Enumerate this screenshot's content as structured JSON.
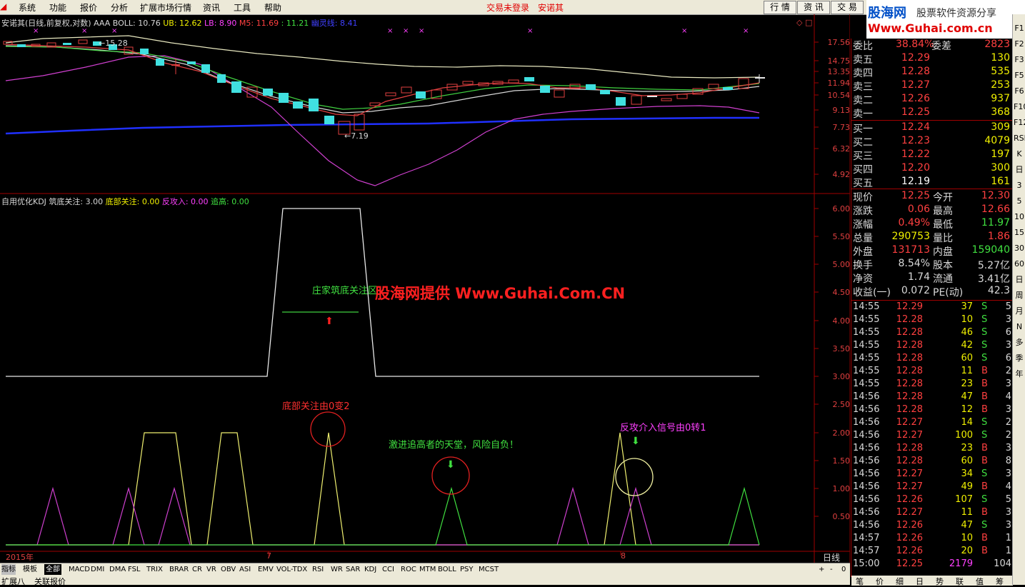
{
  "menu": [
    "系统",
    "功能",
    "报价",
    "分析",
    "扩展市场行情",
    "资讯",
    "工具",
    "帮助"
  ],
  "status": {
    "login": "交易未登录",
    "stock": "安诺其"
  },
  "toolbar_buttons": [
    "行 情",
    "资 讯",
    "交 易"
  ],
  "logo": {
    "line1": "股海网",
    "line1b": "股票软件资源分享",
    "line2": "Www.Guhai.com.cn"
  },
  "main_info": {
    "title": "安诺其(日线,前复权,对数)",
    "aaa": "AAA",
    "boll": "BOLL: 10.76",
    "ub": "UB: 12.62",
    "lb": "LB: 8.90",
    "m5": "M5: 11.69",
    "m10": ": 11.21",
    "ghost": "幽灵线: 8.41"
  },
  "price_axis": [
    "17.56",
    "14.75",
    "13.35",
    "11.94",
    "10.54",
    "9.13",
    "7.73",
    "6.32",
    "4.92"
  ],
  "price_annot": {
    "high": "15.28",
    "low": "7.19"
  },
  "kdj_info": {
    "title": "自用优化KDJ",
    "a": "筑底关注: 3.00",
    "b": "底部关注: 0.00",
    "c": "反攻入: 0.00",
    "d": "追高: 0.00"
  },
  "kdj_axis": [
    "6.00",
    "5.50",
    "5.00",
    "4.50",
    "4.00",
    "3.50",
    "3.00",
    "2.50",
    "2.00",
    "1.50",
    "1.00",
    "0.50"
  ],
  "annotations": {
    "a1": "庄家筑底关注区",
    "a2": "底部关注由0变2",
    "a3": "激进追高者的天堂，风险自负！",
    "a4": "反攻介入信号由0转1",
    "watermark": "股海网提供 Www.Guhai.Com.CN"
  },
  "date_axis": {
    "year": "2015年",
    "m7": "7",
    "m8": "8",
    "period": "日线"
  },
  "indicator_tabs": [
    "指标",
    "模板",
    "全部",
    "MACD",
    "DMI",
    "DMA",
    "FSL",
    "TRIX",
    "BRAR",
    "CR",
    "VR",
    "OBV",
    "ASI",
    "EMV",
    "VOL-TDX",
    "RSI",
    "WR",
    "SAR",
    "KDJ",
    "CCI",
    "ROC",
    "MTM",
    "BOLL",
    "PSY",
    "MCST"
  ],
  "bottom": [
    "扩展八",
    "关联报价"
  ],
  "quote": {
    "ratio": {
      "label": "委比",
      "value": "38.84%",
      "label2": "委差",
      "value2": "2823"
    },
    "sells": [
      {
        "label": "卖五",
        "price": "12.29",
        "vol": "130"
      },
      {
        "label": "卖四",
        "price": "12.28",
        "vol": "535"
      },
      {
        "label": "卖三",
        "price": "12.27",
        "vol": "253"
      },
      {
        "label": "卖二",
        "price": "12.26",
        "vol": "937"
      },
      {
        "label": "卖一",
        "price": "12.25",
        "vol": "368"
      }
    ],
    "buys": [
      {
        "label": "买一",
        "price": "12.24",
        "vol": "309"
      },
      {
        "label": "买二",
        "price": "12.23",
        "vol": "4079"
      },
      {
        "label": "买三",
        "price": "12.22",
        "vol": "197"
      },
      {
        "label": "买四",
        "price": "12.20",
        "vol": "300"
      },
      {
        "label": "买五",
        "price": "12.19",
        "vol": "161"
      }
    ],
    "stats": [
      {
        "l1": "现价",
        "v1": "12.25",
        "l2": "今开",
        "v2": "12.30"
      },
      {
        "l1": "涨跌",
        "v1": "0.06",
        "l2": "最高",
        "v2": "12.66"
      },
      {
        "l1": "涨幅",
        "v1": "0.49%",
        "l2": "最低",
        "v2": "11.97"
      },
      {
        "l1": "总量",
        "v1": "290753",
        "l2": "量比",
        "v2": "1.86"
      },
      {
        "l1": "外盘",
        "v1": "131713",
        "l2": "内盘",
        "v2": "159040"
      },
      {
        "l1": "换手",
        "v1": "8.54%",
        "l2": "股本",
        "v2": "5.27亿"
      },
      {
        "l1": "净资",
        "v1": "1.74",
        "l2": "流通",
        "v2": "3.41亿"
      },
      {
        "l1": "收益(一)",
        "v1": "0.072",
        "l2": "PE(动)",
        "v2": "42.3"
      }
    ],
    "ticks": [
      [
        "14:55",
        "12.29",
        "37",
        "S",
        "5"
      ],
      [
        "14:55",
        "12.28",
        "10",
        "S",
        "3"
      ],
      [
        "14:55",
        "12.28",
        "46",
        "S",
        "6"
      ],
      [
        "14:55",
        "12.28",
        "42",
        "S",
        "3"
      ],
      [
        "14:55",
        "12.28",
        "60",
        "S",
        "6"
      ],
      [
        "14:55",
        "12.28",
        "11",
        "B",
        "2"
      ],
      [
        "14:55",
        "12.28",
        "23",
        "B",
        "3"
      ],
      [
        "14:56",
        "12.28",
        "47",
        "B",
        "4"
      ],
      [
        "14:56",
        "12.28",
        "12",
        "B",
        "3"
      ],
      [
        "14:56",
        "12.27",
        "14",
        "S",
        "2"
      ],
      [
        "14:56",
        "12.27",
        "100",
        "S",
        "2"
      ],
      [
        "14:56",
        "12.28",
        "23",
        "B",
        "3"
      ],
      [
        "14:56",
        "12.28",
        "60",
        "B",
        "8"
      ],
      [
        "14:56",
        "12.27",
        "34",
        "S",
        "3"
      ],
      [
        "14:56",
        "12.27",
        "49",
        "B",
        "4"
      ],
      [
        "14:56",
        "12.26",
        "107",
        "S",
        "5"
      ],
      [
        "14:56",
        "12.27",
        "11",
        "B",
        "3"
      ],
      [
        "14:56",
        "12.26",
        "47",
        "S",
        "3"
      ],
      [
        "14:57",
        "12.26",
        "10",
        "B",
        "1"
      ],
      [
        "14:57",
        "12.26",
        "20",
        "B",
        "1"
      ],
      [
        "15:00",
        "12.25",
        "2179",
        "",
        "104"
      ]
    ],
    "bottom_tabs": [
      "笔",
      "价",
      "细",
      "日",
      "势",
      "联",
      "值",
      "筹"
    ]
  },
  "sidebar": [
    "F1",
    "F2",
    "F3",
    "F5",
    "F6",
    "F10",
    "F12",
    "RSI",
    "K",
    "日",
    "3",
    "5",
    "10",
    "15",
    "30",
    "60",
    "日",
    "周",
    "月",
    "N",
    "多",
    "季",
    "年"
  ]
}
